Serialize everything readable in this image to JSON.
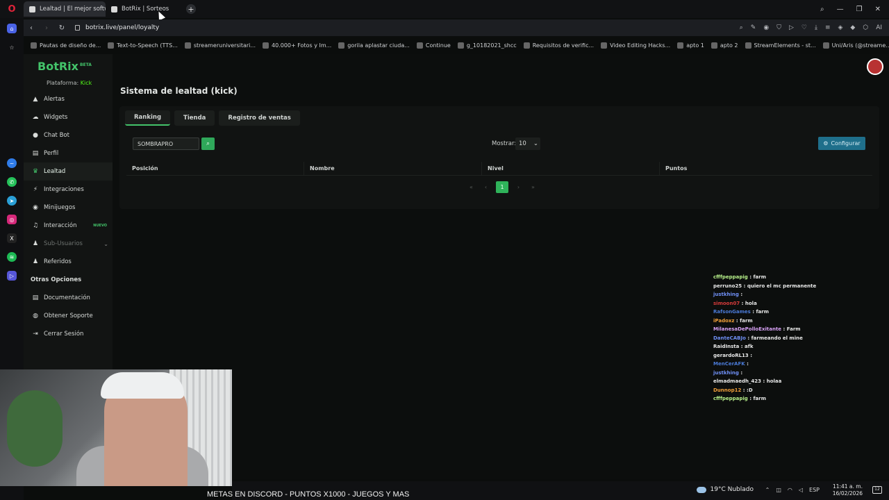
{
  "browser": {
    "tabs": [
      {
        "label": "Lealtad | El mejor softwar",
        "active": true
      },
      {
        "label": "BotRix | Sorteos",
        "active": false
      }
    ],
    "new_tab": "+",
    "url": "botrix.live/panel/loyalty",
    "bookmarks": [
      "Pautas de diseño de...",
      "Text-to-Speech (TTS...",
      "streameruniversitari...",
      "40.000+ Fotos y Im...",
      "gorila aplastar ciuda...",
      "Continue",
      "g_10182021_shcc",
      "Requisitos de verific...",
      "Video Editing Hacks...",
      "apto 1",
      "apto 2",
      "StreamElements - st...",
      "Uni/Aris (@streame..."
    ],
    "ai_label": "AI"
  },
  "app": {
    "brand": "BotRix",
    "brand_tag": "BETA",
    "platform_label": "Plataforma:",
    "platform_value": "Kick",
    "menu": [
      {
        "label": "Alertas",
        "icon": "warning-icon"
      },
      {
        "label": "Widgets",
        "icon": "cloud-icon"
      },
      {
        "label": "Chat Bot",
        "icon": "chat-icon"
      },
      {
        "label": "Perfil",
        "icon": "profile-card-icon"
      },
      {
        "label": "Lealtad",
        "icon": "trophy-icon",
        "active": true
      },
      {
        "label": "Integraciones",
        "icon": "plug-icon"
      },
      {
        "label": "Minijuegos",
        "icon": "gamepad-icon"
      },
      {
        "label": "Interacción",
        "icon": "music-icon",
        "badge": "NUEVO"
      },
      {
        "label": "Sub-Usuarios",
        "icon": "users-icon",
        "dim": true
      },
      {
        "label": "Referidos",
        "icon": "users-group-icon"
      }
    ],
    "section_other": "Otras Opciones",
    "menu_other": [
      {
        "label": "Documentación",
        "icon": "document-icon"
      },
      {
        "label": "Obtener Soporte",
        "icon": "help-icon"
      },
      {
        "label": "Cerrar Sesión",
        "icon": "logout-icon"
      }
    ]
  },
  "page": {
    "title": "Sistema de lealtad (kick)",
    "tabs": [
      "Ranking",
      "Tienda",
      "Registro de ventas"
    ],
    "search_value": "SOMBRAPRO",
    "show_label": "Mostrar:",
    "show_value": "10",
    "config_label": "Configurar",
    "columns": [
      "Posición",
      "Nombre",
      "Nivel",
      "Puntos"
    ],
    "pager": {
      "first": "«",
      "prev": "‹",
      "current": "1",
      "next": "›",
      "last": "»"
    }
  },
  "chat": [
    {
      "user": "cfffpeppapig",
      "text": "farm",
      "color": "#b7f08a"
    },
    {
      "user": "perruno25",
      "text": "quiero el mc permanente",
      "color": "#e8e8e8"
    },
    {
      "user": "justkhing",
      "text": "",
      "color": "#6f8ff5"
    },
    {
      "user": "simoon07",
      "text": "hola",
      "color": "#d83b3b"
    },
    {
      "user": "RafsonGames",
      "text": "farm",
      "color": "#4b7bd8"
    },
    {
      "user": "iPadoxz",
      "text": "farm",
      "color": "#f2a03a"
    },
    {
      "user": "MilanesaDePolloExitante",
      "text": "Farm",
      "color": "#d7a1f5"
    },
    {
      "user": "DanteCABJo",
      "text": "farmeando el mine",
      "color": "#6f8ff5"
    },
    {
      "user": "RaidInsta",
      "text": "afk",
      "color": "#e8e8e8"
    },
    {
      "user": "gerardoRL13",
      "text": "",
      "color": "#e8e8e8"
    },
    {
      "user": "MenCerAFK",
      "text": "",
      "color": "#4b7bd8"
    },
    {
      "user": "justkhing",
      "text": "",
      "color": "#6f8ff5"
    },
    {
      "user": "elmadmaedh_423",
      "text": "holaa",
      "color": "#e8e8e8"
    },
    {
      "user": "Dunnop12",
      "text": ":D",
      "color": "#f2a03a"
    },
    {
      "user": "cfffpeppapig",
      "text": "farm",
      "color": "#b7f08a"
    }
  ],
  "overlay": {
    "marquee": "METAS EN DISCORD - PUNTOS X1000 - JUEGOS Y MAS"
  },
  "taskbar": {
    "weather": "19°C Nublado",
    "lang": "ESP",
    "time": "11:41 a. m.",
    "date": "16/02/2026",
    "notif_count": "12"
  }
}
